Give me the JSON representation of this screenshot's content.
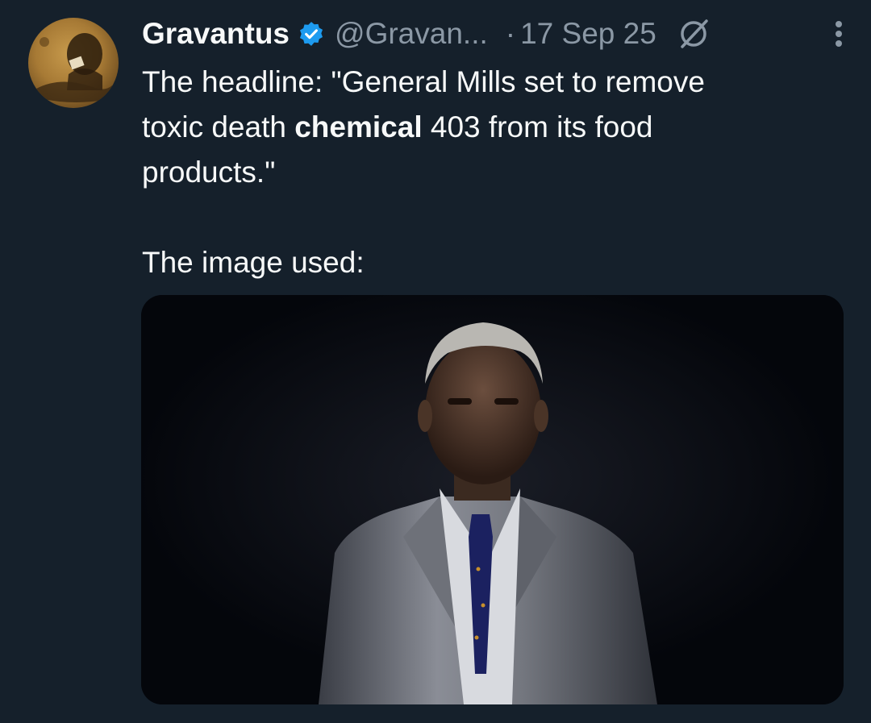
{
  "author": {
    "name": "Gravantus",
    "handle": "@Gravan...",
    "date": "17 Sep 25",
    "dot": "·"
  },
  "icons": {
    "verified": "verified-badge-icon",
    "grok": "grok-icon",
    "more": "more-options-icon"
  },
  "tweet": {
    "line1": "The headline: \"General Mills set to remove",
    "line2_pre": "toxic death ",
    "line2_bold": "chemical",
    "line2_post": " 403 from its food",
    "line3": "products.\"",
    "line4": "The image used:"
  },
  "colors": {
    "background": "#15202b",
    "text": "#f7f9f9",
    "secondary": "#8b98a5",
    "verified": "#1d9bf0"
  }
}
